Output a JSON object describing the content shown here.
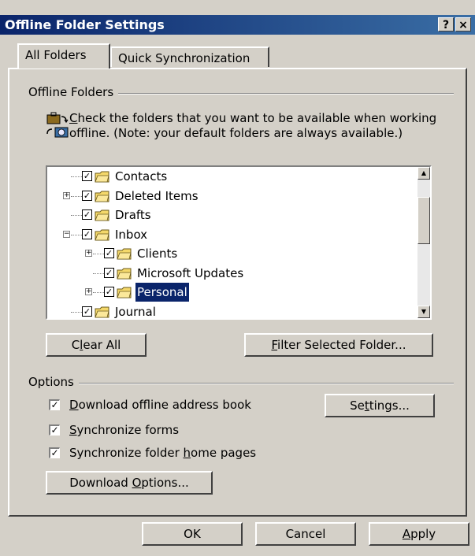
{
  "window": {
    "title": "Offline Folder Settings",
    "help_button": "?",
    "close_button": "×"
  },
  "tabs": [
    {
      "label": "All Folders",
      "active": true
    },
    {
      "label": "Quick Synchronization",
      "active": false
    }
  ],
  "offline_folders": {
    "group_label": "Offline Folders",
    "description_prefix": "C",
    "description_rest": "heck the folders that you want to be available when working offline.  (Note: your default folders are always available.)",
    "tree": [
      {
        "label": "Contacts",
        "checked": true,
        "expander": "",
        "icon": "contacts-icon"
      },
      {
        "label": "Deleted Items",
        "checked": true,
        "expander": "+",
        "icon": "deleted-items-icon"
      },
      {
        "label": "Drafts",
        "checked": true,
        "expander": "",
        "icon": "drafts-icon"
      },
      {
        "label": "Inbox",
        "checked": true,
        "expander": "−",
        "icon": "inbox-icon"
      },
      {
        "label": "Clients",
        "checked": true,
        "expander": "+",
        "icon": "folder-icon"
      },
      {
        "label": "Microsoft Updates",
        "checked": true,
        "expander": "",
        "icon": "folder-icon"
      },
      {
        "label": "Personal",
        "checked": true,
        "expander": "+",
        "icon": "folder-icon",
        "selected": true
      },
      {
        "label": "Journal",
        "checked": true,
        "expander": "",
        "icon": "journal-icon"
      }
    ],
    "clear_all_pre": "C",
    "clear_all_key": "l",
    "clear_all_post": "ear All",
    "filter_key": "F",
    "filter_post": "ilter Selected Folder..."
  },
  "options": {
    "group_label": "Options",
    "download_address_book": {
      "key": "D",
      "rest": "ownload offline address book",
      "checked": true
    },
    "sync_forms": {
      "key": "S",
      "rest": "ynchronize forms",
      "checked": true
    },
    "sync_home_pages": {
      "pre": "Synchronize folder ",
      "key": "h",
      "rest": "ome pages",
      "checked": true
    },
    "settings_pre": "Se",
    "settings_key": "t",
    "settings_post": "tings...",
    "download_options_pre": "Download ",
    "download_options_key": "O",
    "download_options_post": "ptions..."
  },
  "footer": {
    "ok": "OK",
    "cancel": "Cancel",
    "apply_key": "A",
    "apply_post": "pply"
  },
  "colors": {
    "titlebar_start": "#0a246a",
    "titlebar_end": "#3a6ea5",
    "face": "#d4d0c8",
    "selection": "#0a246a"
  }
}
